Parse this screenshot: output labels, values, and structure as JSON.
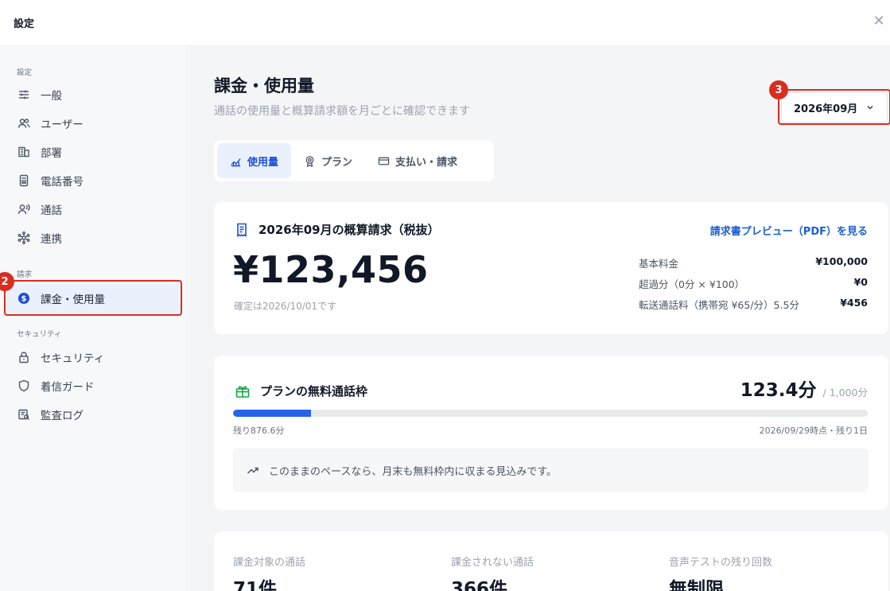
{
  "window": {
    "title": "設定",
    "close_glyph": "✕"
  },
  "sidebar": {
    "sections": [
      {
        "label": "設定"
      },
      {
        "label": "請求"
      },
      {
        "label": "セキュリティ"
      }
    ],
    "items": [
      {
        "label": "一般",
        "icon": "sliders-icon"
      },
      {
        "label": "ユーザー",
        "icon": "users-icon"
      },
      {
        "label": "部署",
        "icon": "building-icon"
      },
      {
        "label": "電話番号",
        "icon": "phone-icon"
      },
      {
        "label": "通話",
        "icon": "call-voice-icon"
      },
      {
        "label": "連携",
        "icon": "integration-icon"
      },
      {
        "label": "課金・使用量",
        "icon": "dollar-circle-icon",
        "active": true
      },
      {
        "label": "セキュリティ",
        "icon": "lock-icon"
      },
      {
        "label": "着信ガード",
        "icon": "shield-icon"
      },
      {
        "label": "監査ログ",
        "icon": "audit-log-icon"
      }
    ]
  },
  "annotations": {
    "badge_2": "2",
    "badge_3": "3",
    "color": "#d92d20"
  },
  "main": {
    "title": "課金・使用量",
    "subtitle": "通話の使用量と概算請求額を月ごとに確認できます",
    "month_select": "2026年09月",
    "tabs": [
      {
        "label": "使用量",
        "icon": "chart-icon",
        "active": true
      },
      {
        "label": "プラン",
        "icon": "award-icon"
      },
      {
        "label": "支払い・請求",
        "icon": "credit-card-icon"
      }
    ],
    "bill": {
      "heading": "2026年09月の概算請求（税抜）",
      "pdf_link": "請求書プレビュー（PDF）を見る",
      "amount": "¥123,456",
      "confirm_note": "確定は2026/10/01です",
      "breakdown": [
        {
          "label": "基本料金",
          "value": "¥100,000"
        },
        {
          "label": "超過分（0分 × ¥100）",
          "value": "¥0"
        },
        {
          "label": "転送通話料（携帯宛 ¥65/分）5.5分",
          "value": "¥456"
        }
      ]
    },
    "plan": {
      "heading": "プランの無料通話枠",
      "used": "123.4分",
      "total": "/ 1,000分",
      "progress_fraction": 0.1234,
      "remaining": "残り876.6分",
      "as_of": "2026/09/29時点・残り1日",
      "note": "このままのペースなら、月末も無料枠内に収まる見込みです。"
    },
    "stats": [
      {
        "label": "課金対象の通話",
        "value": "71件"
      },
      {
        "label": "課金されない通話",
        "value": "366件"
      },
      {
        "label": "音声テストの残り回数",
        "value": "無制限"
      }
    ]
  },
  "colors": {
    "accent": "#2563eb",
    "link": "#1d5fd1",
    "active_bg": "#eaf1fd",
    "annotation": "#d92d20"
  }
}
